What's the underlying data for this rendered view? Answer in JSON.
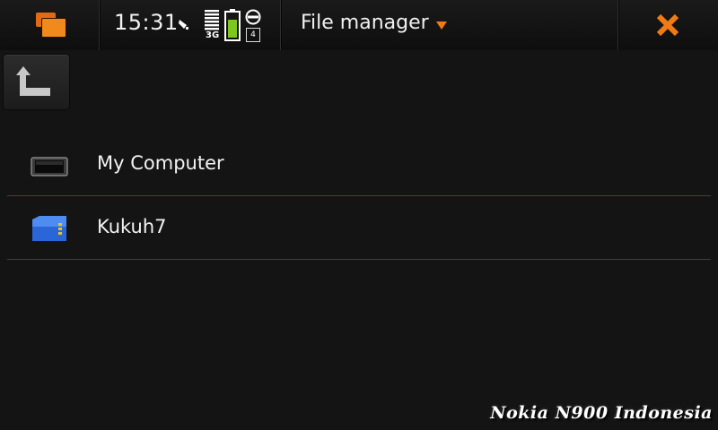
{
  "statusbar": {
    "time": "15:31",
    "network_type": "3G",
    "notification_count": "4",
    "icons": [
      "task-switcher-icon",
      "alarm-icon",
      "signal-strength-icon",
      "battery-icon",
      "presence-icon",
      "close-icon"
    ]
  },
  "titlebar": {
    "title": "File manager"
  },
  "toolbar": {
    "up_icon": "up-folder-icon"
  },
  "list": {
    "items": [
      {
        "label": "My Computer",
        "icon": "device-icon"
      },
      {
        "label": "Kukuh7",
        "icon": "memory-card-icon"
      }
    ]
  },
  "watermark": "Nokia N900 Indonesia",
  "colors": {
    "accent": "#f07a14",
    "background": "#141414",
    "divider": "#5a3a16",
    "battery": "#7cc81e",
    "card": "#2a66d8"
  }
}
